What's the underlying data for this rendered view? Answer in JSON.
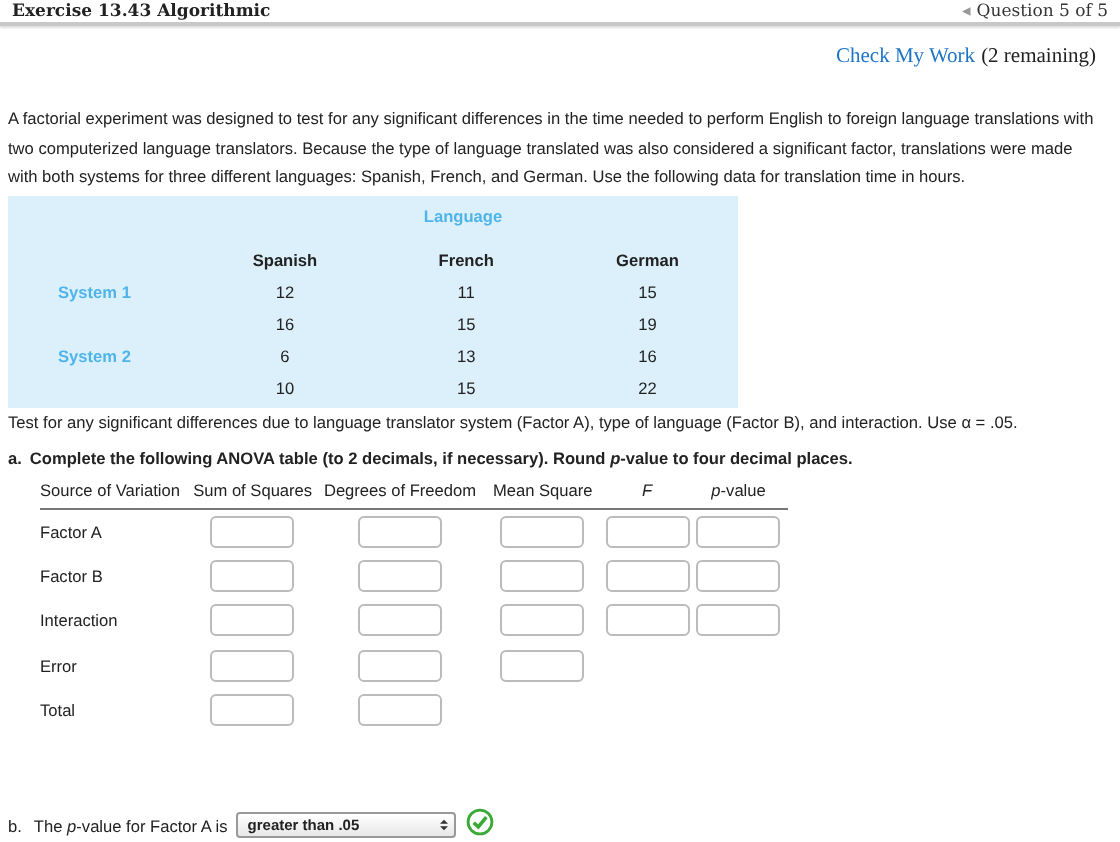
{
  "header": {
    "title": "Exercise 13.43 Algorithmic",
    "nav_arrow": "◂",
    "question": "Question 5 of 5"
  },
  "check": {
    "link": "Check My Work",
    "remaining": "(2 remaining)"
  },
  "intro": "A factorial experiment was designed to test for any significant differences in the time needed to perform English to foreign language translations with two computerized language translators. Because the type of language translated was also considered a significant factor, translations were made with both systems for three different languages: Spanish, French, and German. Use the following data for translation time in hours.",
  "data_table": {
    "group_heading": "Language",
    "columns": [
      "Spanish",
      "French",
      "German"
    ],
    "rows": [
      {
        "label": "System 1",
        "values": [
          "12",
          "11",
          "15"
        ]
      },
      {
        "label": "",
        "values": [
          "16",
          "15",
          "19"
        ]
      },
      {
        "label": "System 2",
        "values": [
          "6",
          "13",
          "16"
        ]
      },
      {
        "label": "",
        "values": [
          "10",
          "15",
          "22"
        ]
      }
    ]
  },
  "test_text": "Test for any significant differences due to language translator system (Factor A), type of language (Factor B), and interaction. Use α = .05.",
  "part_a": {
    "marker": "a.",
    "instruction": "Complete the following ANOVA table (to 2 decimals, if necessary). Round *p*-value to four decimal places.",
    "columns": [
      {
        "label": "Source of Variation",
        "italic": false
      },
      {
        "label": "Sum of Squares",
        "italic": false
      },
      {
        "label": "Degrees of Freedom",
        "italic": false
      },
      {
        "label": "Mean Square",
        "italic": false
      },
      {
        "label": "F",
        "italic": true
      },
      {
        "label": "*p*-value",
        "italic": false
      }
    ],
    "rows": [
      {
        "source": "Factor A",
        "kind": "effect"
      },
      {
        "source": "Factor B",
        "kind": "effect"
      },
      {
        "source": "Interaction",
        "kind": "effect"
      },
      {
        "source": "Error",
        "kind": "error"
      },
      {
        "source": "Total",
        "kind": "total"
      }
    ]
  },
  "part_b": {
    "marker": "b.",
    "text": "The *p*-value for Factor A is",
    "dropdown": "greater than .05",
    "correct": true
  }
}
